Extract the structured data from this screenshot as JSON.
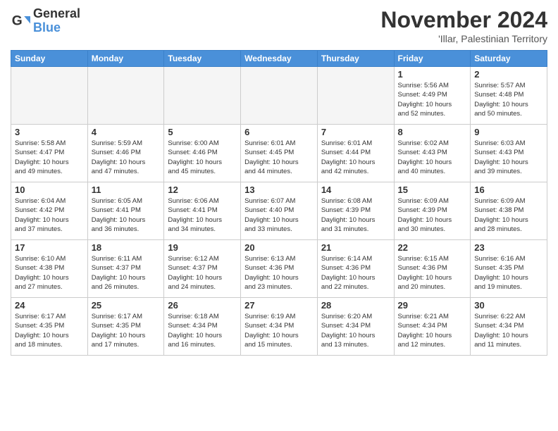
{
  "logo": {
    "text_general": "General",
    "text_blue": "Blue"
  },
  "header": {
    "month": "November 2024",
    "location": "'Illar, Palestinian Territory"
  },
  "weekdays": [
    "Sunday",
    "Monday",
    "Tuesday",
    "Wednesday",
    "Thursday",
    "Friday",
    "Saturday"
  ],
  "weeks": [
    [
      {
        "day": "",
        "info": ""
      },
      {
        "day": "",
        "info": ""
      },
      {
        "day": "",
        "info": ""
      },
      {
        "day": "",
        "info": ""
      },
      {
        "day": "",
        "info": ""
      },
      {
        "day": "1",
        "info": "Sunrise: 5:56 AM\nSunset: 4:49 PM\nDaylight: 10 hours\nand 52 minutes."
      },
      {
        "day": "2",
        "info": "Sunrise: 5:57 AM\nSunset: 4:48 PM\nDaylight: 10 hours\nand 50 minutes."
      }
    ],
    [
      {
        "day": "3",
        "info": "Sunrise: 5:58 AM\nSunset: 4:47 PM\nDaylight: 10 hours\nand 49 minutes."
      },
      {
        "day": "4",
        "info": "Sunrise: 5:59 AM\nSunset: 4:46 PM\nDaylight: 10 hours\nand 47 minutes."
      },
      {
        "day": "5",
        "info": "Sunrise: 6:00 AM\nSunset: 4:46 PM\nDaylight: 10 hours\nand 45 minutes."
      },
      {
        "day": "6",
        "info": "Sunrise: 6:01 AM\nSunset: 4:45 PM\nDaylight: 10 hours\nand 44 minutes."
      },
      {
        "day": "7",
        "info": "Sunrise: 6:01 AM\nSunset: 4:44 PM\nDaylight: 10 hours\nand 42 minutes."
      },
      {
        "day": "8",
        "info": "Sunrise: 6:02 AM\nSunset: 4:43 PM\nDaylight: 10 hours\nand 40 minutes."
      },
      {
        "day": "9",
        "info": "Sunrise: 6:03 AM\nSunset: 4:43 PM\nDaylight: 10 hours\nand 39 minutes."
      }
    ],
    [
      {
        "day": "10",
        "info": "Sunrise: 6:04 AM\nSunset: 4:42 PM\nDaylight: 10 hours\nand 37 minutes."
      },
      {
        "day": "11",
        "info": "Sunrise: 6:05 AM\nSunset: 4:41 PM\nDaylight: 10 hours\nand 36 minutes."
      },
      {
        "day": "12",
        "info": "Sunrise: 6:06 AM\nSunset: 4:41 PM\nDaylight: 10 hours\nand 34 minutes."
      },
      {
        "day": "13",
        "info": "Sunrise: 6:07 AM\nSunset: 4:40 PM\nDaylight: 10 hours\nand 33 minutes."
      },
      {
        "day": "14",
        "info": "Sunrise: 6:08 AM\nSunset: 4:39 PM\nDaylight: 10 hours\nand 31 minutes."
      },
      {
        "day": "15",
        "info": "Sunrise: 6:09 AM\nSunset: 4:39 PM\nDaylight: 10 hours\nand 30 minutes."
      },
      {
        "day": "16",
        "info": "Sunrise: 6:09 AM\nSunset: 4:38 PM\nDaylight: 10 hours\nand 28 minutes."
      }
    ],
    [
      {
        "day": "17",
        "info": "Sunrise: 6:10 AM\nSunset: 4:38 PM\nDaylight: 10 hours\nand 27 minutes."
      },
      {
        "day": "18",
        "info": "Sunrise: 6:11 AM\nSunset: 4:37 PM\nDaylight: 10 hours\nand 26 minutes."
      },
      {
        "day": "19",
        "info": "Sunrise: 6:12 AM\nSunset: 4:37 PM\nDaylight: 10 hours\nand 24 minutes."
      },
      {
        "day": "20",
        "info": "Sunrise: 6:13 AM\nSunset: 4:36 PM\nDaylight: 10 hours\nand 23 minutes."
      },
      {
        "day": "21",
        "info": "Sunrise: 6:14 AM\nSunset: 4:36 PM\nDaylight: 10 hours\nand 22 minutes."
      },
      {
        "day": "22",
        "info": "Sunrise: 6:15 AM\nSunset: 4:36 PM\nDaylight: 10 hours\nand 20 minutes."
      },
      {
        "day": "23",
        "info": "Sunrise: 6:16 AM\nSunset: 4:35 PM\nDaylight: 10 hours\nand 19 minutes."
      }
    ],
    [
      {
        "day": "24",
        "info": "Sunrise: 6:17 AM\nSunset: 4:35 PM\nDaylight: 10 hours\nand 18 minutes."
      },
      {
        "day": "25",
        "info": "Sunrise: 6:17 AM\nSunset: 4:35 PM\nDaylight: 10 hours\nand 17 minutes."
      },
      {
        "day": "26",
        "info": "Sunrise: 6:18 AM\nSunset: 4:34 PM\nDaylight: 10 hours\nand 16 minutes."
      },
      {
        "day": "27",
        "info": "Sunrise: 6:19 AM\nSunset: 4:34 PM\nDaylight: 10 hours\nand 15 minutes."
      },
      {
        "day": "28",
        "info": "Sunrise: 6:20 AM\nSunset: 4:34 PM\nDaylight: 10 hours\nand 13 minutes."
      },
      {
        "day": "29",
        "info": "Sunrise: 6:21 AM\nSunset: 4:34 PM\nDaylight: 10 hours\nand 12 minutes."
      },
      {
        "day": "30",
        "info": "Sunrise: 6:22 AM\nSunset: 4:34 PM\nDaylight: 10 hours\nand 11 minutes."
      }
    ]
  ]
}
